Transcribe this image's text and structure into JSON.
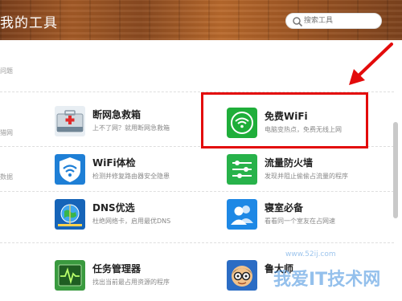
{
  "header": {
    "title": "我的工具"
  },
  "search": {
    "placeholder": "搜索工具",
    "icon": "search-icon"
  },
  "left_fragments": [
    "问题",
    "猎网",
    "数据"
  ],
  "tools": [
    {
      "id": "net-rescue",
      "name": "断网急救箱",
      "desc": "上不了网？就用断网急救箱",
      "icon": "first-aid-kit-icon"
    },
    {
      "id": "free-wifi",
      "name": "免费WiFi",
      "desc": "电脑变热点，免费无线上网",
      "icon": "wifi-icon"
    },
    {
      "id": "wifi-check",
      "name": "WiFi体检",
      "desc": "检测并修复路由器安全隐患",
      "icon": "wifi-shield-icon"
    },
    {
      "id": "traffic-firewall",
      "name": "流量防火墙",
      "desc": "发现并阻止偷偷占流量的程序",
      "icon": "traffic-sliders-icon"
    },
    {
      "id": "dns",
      "name": "DNS优选",
      "desc": "杜绝网络卡，启用最优DNS",
      "icon": "dns-globe-icon"
    },
    {
      "id": "dorm",
      "name": "寝室必备",
      "desc": "看看同一个室友在占网速",
      "icon": "roommates-icon"
    },
    {
      "id": "task-manager",
      "name": "任务管理器",
      "desc": "找出当前最占用资源的程序",
      "icon": "pulse-monitor-icon"
    },
    {
      "id": "ludashi",
      "name": "鲁大师",
      "desc": "",
      "icon": "ludashi-avatar-icon"
    }
  ],
  "colors": {
    "highlight": "#e30b0b",
    "accent_green": "#1fae3a",
    "accent_blue": "#1e7fd6"
  },
  "watermark": {
    "main": "我爱IT技术网",
    "sub": "www.52ij.com"
  }
}
